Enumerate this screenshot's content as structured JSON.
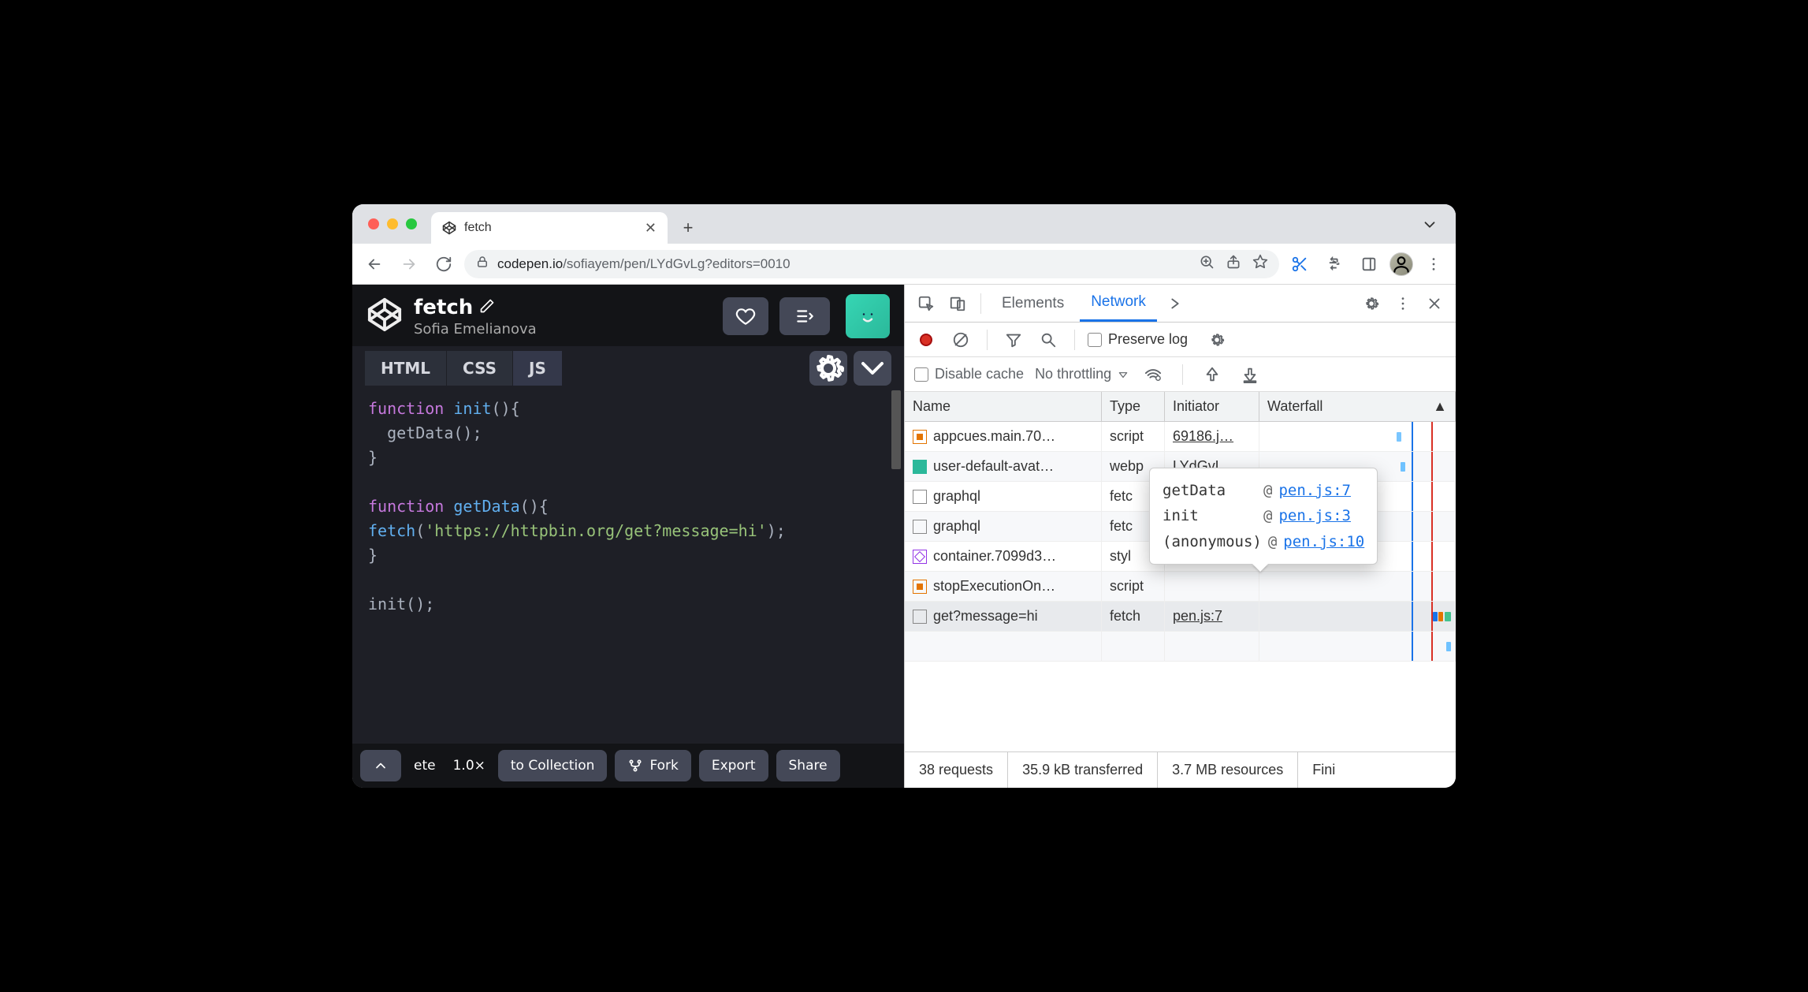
{
  "browser": {
    "tab_title": "fetch",
    "url_host": "codepen.io",
    "url_path": "/sofiayem/pen/LYdGvLg?editors=0010"
  },
  "codepen": {
    "title": "fetch",
    "author": "Sofia Emelianova",
    "tabs": {
      "html": "HTML",
      "css": "CSS",
      "js": "JS"
    },
    "code": {
      "l1_kw": "function",
      "l1_fn": "init",
      "l1_rest": "(){",
      "l2": "  getData();",
      "l3": "}",
      "l4_kw": "function",
      "l4_fn": "getData",
      "l4_rest": "(){",
      "l5_fn": "  fetch",
      "l5_str": "'https://httpbin.org/get?message=hi'",
      "l5_end": ");",
      "l5_open": "(",
      "l6": "}",
      "l7": "init();"
    },
    "footer": {
      "frag1": "ete",
      "zoom": "1.0×",
      "to_collection": "to Collection",
      "fork": "Fork",
      "export": "Export",
      "share": "Share"
    }
  },
  "devtools": {
    "tabs": {
      "elements": "Elements",
      "network": "Network"
    },
    "toolbar": {
      "preserve_log": "Preserve log",
      "disable_cache": "Disable cache",
      "throttling": "No throttling"
    },
    "columns": {
      "name": "Name",
      "type": "Type",
      "initiator": "Initiator",
      "waterfall": "Waterfall"
    },
    "rows": [
      {
        "name": "appcues.main.70…",
        "type": "script",
        "initiator": "69186.j…",
        "icon": "js"
      },
      {
        "name": "user-default-avat…",
        "type": "webp",
        "initiator": "LYdGvL…",
        "icon": "img"
      },
      {
        "name": "graphql",
        "type": "fetc",
        "initiator": "",
        "icon": "doc"
      },
      {
        "name": "graphql",
        "type": "fetc",
        "initiator": "",
        "icon": "doc"
      },
      {
        "name": "container.7099d3…",
        "type": "styl",
        "initiator": "",
        "icon": "css"
      },
      {
        "name": "stopExecutionOn…",
        "type": "script",
        "initiator": "",
        "icon": "js"
      },
      {
        "name": "get?message=hi",
        "type": "fetch",
        "initiator": "pen.js:7",
        "icon": "doc"
      }
    ],
    "tooltip": [
      {
        "fn": "getData",
        "at": "@",
        "link": "pen.js:7"
      },
      {
        "fn": "init",
        "at": "@",
        "link": "pen.js:3"
      },
      {
        "fn": "(anonymous)",
        "at": "@",
        "link": "pen.js:10"
      }
    ],
    "status": {
      "requests": "38 requests",
      "transferred": "35.9 kB transferred",
      "resources": "3.7 MB resources",
      "finish": "Fini"
    }
  }
}
